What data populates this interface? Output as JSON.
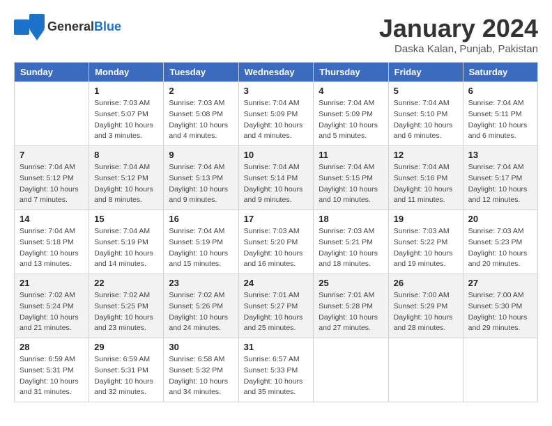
{
  "logo": {
    "general": "General",
    "blue": "Blue"
  },
  "title": "January 2024",
  "location": "Daska Kalan, Punjab, Pakistan",
  "days_of_week": [
    "Sunday",
    "Monday",
    "Tuesday",
    "Wednesday",
    "Thursday",
    "Friday",
    "Saturday"
  ],
  "weeks": [
    [
      {
        "day": "",
        "info": ""
      },
      {
        "day": "1",
        "info": "Sunrise: 7:03 AM\nSunset: 5:07 PM\nDaylight: 10 hours\nand 3 minutes."
      },
      {
        "day": "2",
        "info": "Sunrise: 7:03 AM\nSunset: 5:08 PM\nDaylight: 10 hours\nand 4 minutes."
      },
      {
        "day": "3",
        "info": "Sunrise: 7:04 AM\nSunset: 5:09 PM\nDaylight: 10 hours\nand 4 minutes."
      },
      {
        "day": "4",
        "info": "Sunrise: 7:04 AM\nSunset: 5:09 PM\nDaylight: 10 hours\nand 5 minutes."
      },
      {
        "day": "5",
        "info": "Sunrise: 7:04 AM\nSunset: 5:10 PM\nDaylight: 10 hours\nand 6 minutes."
      },
      {
        "day": "6",
        "info": "Sunrise: 7:04 AM\nSunset: 5:11 PM\nDaylight: 10 hours\nand 6 minutes."
      }
    ],
    [
      {
        "day": "7",
        "info": "Sunrise: 7:04 AM\nSunset: 5:12 PM\nDaylight: 10 hours\nand 7 minutes."
      },
      {
        "day": "8",
        "info": "Sunrise: 7:04 AM\nSunset: 5:12 PM\nDaylight: 10 hours\nand 8 minutes."
      },
      {
        "day": "9",
        "info": "Sunrise: 7:04 AM\nSunset: 5:13 PM\nDaylight: 10 hours\nand 9 minutes."
      },
      {
        "day": "10",
        "info": "Sunrise: 7:04 AM\nSunset: 5:14 PM\nDaylight: 10 hours\nand 9 minutes."
      },
      {
        "day": "11",
        "info": "Sunrise: 7:04 AM\nSunset: 5:15 PM\nDaylight: 10 hours\nand 10 minutes."
      },
      {
        "day": "12",
        "info": "Sunrise: 7:04 AM\nSunset: 5:16 PM\nDaylight: 10 hours\nand 11 minutes."
      },
      {
        "day": "13",
        "info": "Sunrise: 7:04 AM\nSunset: 5:17 PM\nDaylight: 10 hours\nand 12 minutes."
      }
    ],
    [
      {
        "day": "14",
        "info": "Sunrise: 7:04 AM\nSunset: 5:18 PM\nDaylight: 10 hours\nand 13 minutes."
      },
      {
        "day": "15",
        "info": "Sunrise: 7:04 AM\nSunset: 5:19 PM\nDaylight: 10 hours\nand 14 minutes."
      },
      {
        "day": "16",
        "info": "Sunrise: 7:04 AM\nSunset: 5:19 PM\nDaylight: 10 hours\nand 15 minutes."
      },
      {
        "day": "17",
        "info": "Sunrise: 7:03 AM\nSunset: 5:20 PM\nDaylight: 10 hours\nand 16 minutes."
      },
      {
        "day": "18",
        "info": "Sunrise: 7:03 AM\nSunset: 5:21 PM\nDaylight: 10 hours\nand 18 minutes."
      },
      {
        "day": "19",
        "info": "Sunrise: 7:03 AM\nSunset: 5:22 PM\nDaylight: 10 hours\nand 19 minutes."
      },
      {
        "day": "20",
        "info": "Sunrise: 7:03 AM\nSunset: 5:23 PM\nDaylight: 10 hours\nand 20 minutes."
      }
    ],
    [
      {
        "day": "21",
        "info": "Sunrise: 7:02 AM\nSunset: 5:24 PM\nDaylight: 10 hours\nand 21 minutes."
      },
      {
        "day": "22",
        "info": "Sunrise: 7:02 AM\nSunset: 5:25 PM\nDaylight: 10 hours\nand 23 minutes."
      },
      {
        "day": "23",
        "info": "Sunrise: 7:02 AM\nSunset: 5:26 PM\nDaylight: 10 hours\nand 24 minutes."
      },
      {
        "day": "24",
        "info": "Sunrise: 7:01 AM\nSunset: 5:27 PM\nDaylight: 10 hours\nand 25 minutes."
      },
      {
        "day": "25",
        "info": "Sunrise: 7:01 AM\nSunset: 5:28 PM\nDaylight: 10 hours\nand 27 minutes."
      },
      {
        "day": "26",
        "info": "Sunrise: 7:00 AM\nSunset: 5:29 PM\nDaylight: 10 hours\nand 28 minutes."
      },
      {
        "day": "27",
        "info": "Sunrise: 7:00 AM\nSunset: 5:30 PM\nDaylight: 10 hours\nand 29 minutes."
      }
    ],
    [
      {
        "day": "28",
        "info": "Sunrise: 6:59 AM\nSunset: 5:31 PM\nDaylight: 10 hours\nand 31 minutes."
      },
      {
        "day": "29",
        "info": "Sunrise: 6:59 AM\nSunset: 5:31 PM\nDaylight: 10 hours\nand 32 minutes."
      },
      {
        "day": "30",
        "info": "Sunrise: 6:58 AM\nSunset: 5:32 PM\nDaylight: 10 hours\nand 34 minutes."
      },
      {
        "day": "31",
        "info": "Sunrise: 6:57 AM\nSunset: 5:33 PM\nDaylight: 10 hours\nand 35 minutes."
      },
      {
        "day": "",
        "info": ""
      },
      {
        "day": "",
        "info": ""
      },
      {
        "day": "",
        "info": ""
      }
    ]
  ]
}
